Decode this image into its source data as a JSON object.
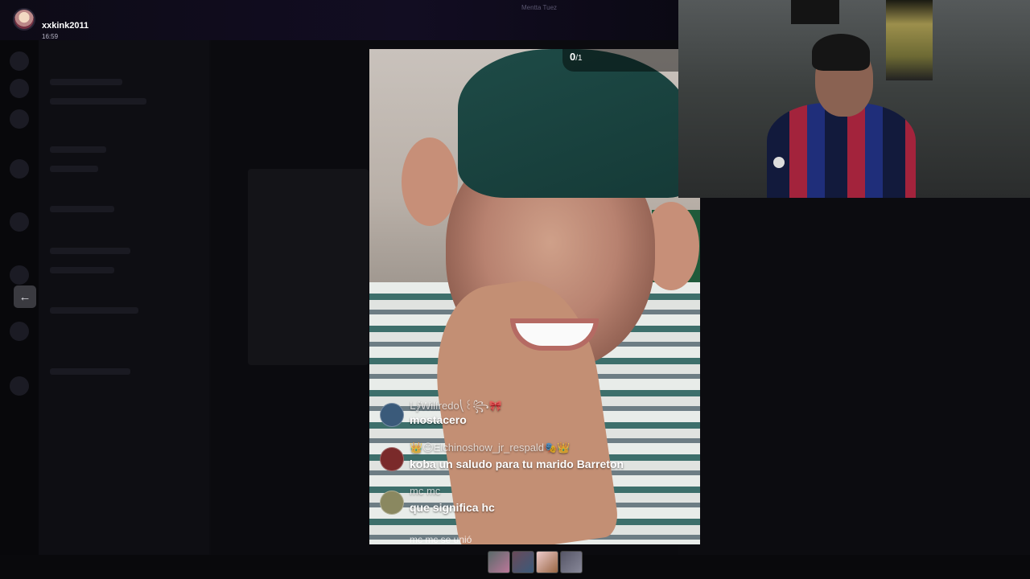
{
  "header": {
    "username": "xxkink2011",
    "timestamp": "16:59",
    "title": "Mentta Tuez"
  },
  "video": {
    "counter_current": "0",
    "counter_total": "/1"
  },
  "comments": [
    {
      "user": "ᒪ⨓Wilfredo⎝꒰꧂🎀",
      "text": "mostacero",
      "avatar_color": "#3a5a7a"
    },
    {
      "user": "👑😊Elchinoshow_jr_respald🎭👑",
      "text": "koba un saludo para tu marido Barreton",
      "avatar_color": "#7a2a2a"
    },
    {
      "user": "mc mc",
      "text": "que significa hc",
      "avatar_color": "#8a8860"
    }
  ],
  "join_notice": "mc mc se unió",
  "thumbnails": [
    "thumb-1",
    "thumb-2",
    "thumb-3",
    "thumb-4"
  ]
}
